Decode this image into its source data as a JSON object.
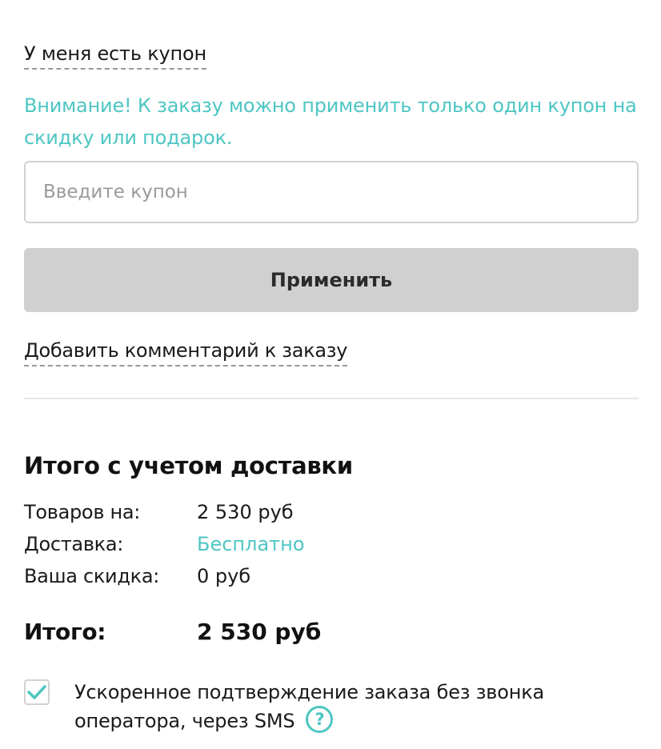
{
  "coupon": {
    "toggle_label": "У меня есть купон",
    "notice": "Внимание! К заказу можно применить только один купон на скидку или подарок.",
    "input_value": "",
    "input_placeholder": "Введите купон",
    "apply_label": "Применить"
  },
  "comment": {
    "toggle_label": "Добавить комментарий к заказу"
  },
  "summary": {
    "title": "Итого с учетом доставки",
    "rows": [
      {
        "label": "Товаров на:",
        "value": "2 530 руб"
      },
      {
        "label": "Доставка:",
        "value": "Бесплатно"
      },
      {
        "label": "Ваша скидка:",
        "value": "0 руб"
      }
    ],
    "total": {
      "label": "Итого:",
      "value": "2 530 руб"
    }
  },
  "sms_confirm": {
    "checked": true,
    "label": "Ускоренное подтверждение заказа без звонка оператора, через SMS",
    "help_icon": "question-circle-icon",
    "help_glyph": "?"
  },
  "colors": {
    "accent": "#4ec6c3",
    "button_bg": "#d0d0d0",
    "text": "#1a1a1a",
    "border": "#d2d2d2"
  }
}
